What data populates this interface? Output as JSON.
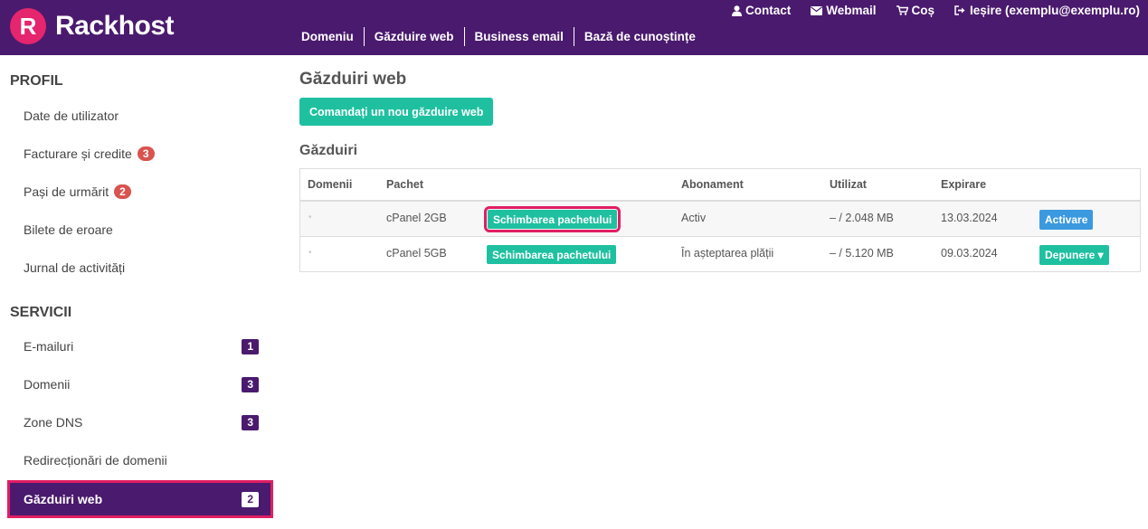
{
  "brand": {
    "logo_letter": "R",
    "name": "Rackhost"
  },
  "top_links": [
    {
      "icon": "user-icon",
      "label": "Contact"
    },
    {
      "icon": "envelope-icon",
      "label": "Webmail"
    },
    {
      "icon": "cart-icon",
      "label": "Coș"
    },
    {
      "icon": "logout-icon",
      "label": "Ieșire (exemplu@exemplu.ro)"
    }
  ],
  "main_nav": [
    "Domeniu",
    "Găzduire web",
    "Business email",
    "Bază de cunoștințe"
  ],
  "sidebar": {
    "profile_heading": "PROFIL",
    "profile_items": [
      {
        "label": "Date de utilizator"
      },
      {
        "label": "Facturare și credite",
        "badge": "3"
      },
      {
        "label": "Pași de urmărit",
        "badge": "2"
      },
      {
        "label": "Bilete de eroare"
      },
      {
        "label": "Jurnal de activități"
      }
    ],
    "services_heading": "SERVICII",
    "services_items": [
      {
        "label": "E-mailuri",
        "badge": "1"
      },
      {
        "label": "Domenii",
        "badge": "3"
      },
      {
        "label": "Zone DNS",
        "badge": "3"
      },
      {
        "label": "Redirecționări de domenii"
      },
      {
        "label": "Găzduiri web",
        "badge": "2"
      }
    ]
  },
  "main": {
    "title": "Găzduiri web",
    "order_button": "Comandați un nou găzduire web",
    "section_title": "Găzduiri",
    "table": {
      "headers": [
        "Domenii",
        "Pachet",
        "Abonament",
        "Utilizat",
        "Expirare"
      ],
      "rows": [
        {
          "domain": "•",
          "package": "cPanel 2GB",
          "change_button": "Schimbarea pachetului",
          "subscription": "Activ",
          "used": "– / 2.048 MB",
          "expiry": "13.03.2024",
          "action": "Activare"
        },
        {
          "domain": "•",
          "package": "cPanel 5GB",
          "change_button": "Schimbarea pachetului",
          "subscription": "În așteptarea plății",
          "used": "– / 5.120 MB",
          "expiry": "09.03.2024",
          "action": "Depunere ▾"
        }
      ]
    }
  },
  "colors": {
    "header_bg": "#4a1a6e",
    "accent_green": "#1fc0a0",
    "accent_blue": "#3b99e0",
    "highlight": "#e01e63",
    "badge_red": "#d9534f"
  }
}
